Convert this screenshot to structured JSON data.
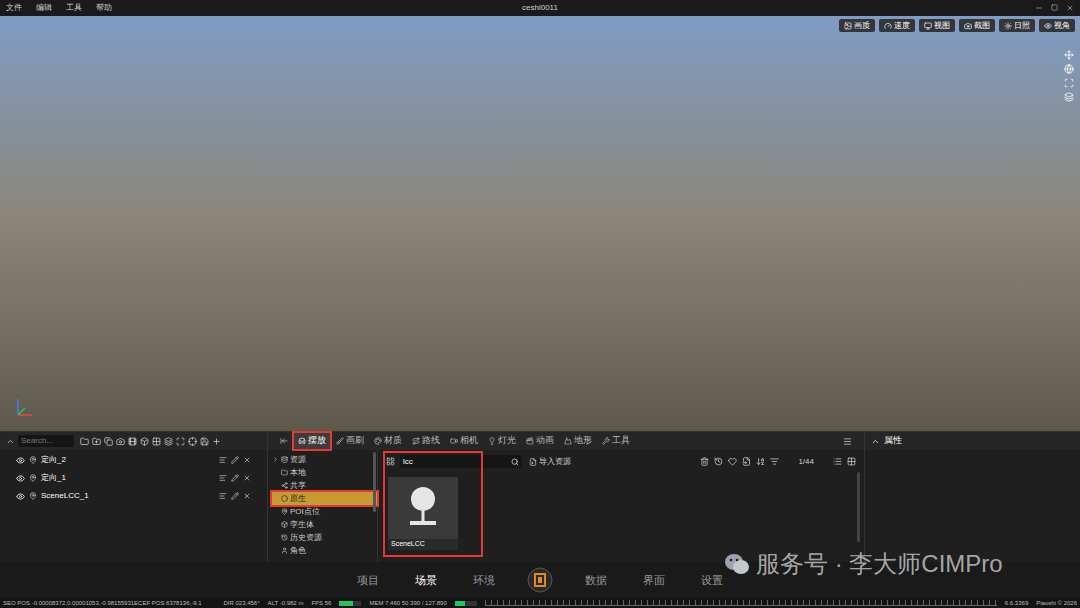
{
  "window": {
    "title": "ceshi0011",
    "menu": [
      "文件",
      "编辑",
      "工具",
      "帮助"
    ]
  },
  "viewport": {
    "toolbar": [
      {
        "label": "画质"
      },
      {
        "label": "速度"
      },
      {
        "label": "视图"
      },
      {
        "label": "截图"
      },
      {
        "label": "日照"
      },
      {
        "label": "视角"
      }
    ]
  },
  "outliner": {
    "search": {
      "placeholder": "Search..."
    },
    "items": [
      {
        "name": "定向_2",
        "visible": true,
        "selected": false
      },
      {
        "name": "定向_1",
        "visible": true,
        "selected": false
      },
      {
        "name": "SceneLCC_1",
        "visible": true,
        "selected": false
      }
    ]
  },
  "library": {
    "tabs": [
      {
        "label": "摆放",
        "selected": true,
        "annotated": true
      },
      {
        "label": "画刷",
        "selected": false,
        "annotated": false
      },
      {
        "label": "材质",
        "selected": false,
        "annotated": false
      },
      {
        "label": "路线",
        "selected": false,
        "annotated": false
      },
      {
        "label": "相机",
        "selected": false,
        "annotated": false
      },
      {
        "label": "灯光",
        "selected": false,
        "annotated": false
      },
      {
        "label": "动画",
        "selected": false,
        "annotated": false
      },
      {
        "label": "地形",
        "selected": false,
        "annotated": false
      },
      {
        "label": "工具",
        "selected": false,
        "annotated": false
      }
    ],
    "tree": [
      {
        "label": "资源",
        "selected": false,
        "annotated": false,
        "expandable": true
      },
      {
        "label": "本地",
        "selected": false,
        "annotated": false,
        "expandable": false
      },
      {
        "label": "共享",
        "selected": false,
        "annotated": false,
        "expandable": false
      },
      {
        "label": "原生",
        "selected": true,
        "annotated": true,
        "expandable": false
      },
      {
        "label": "POI点位",
        "selected": false,
        "annotated": false,
        "expandable": false
      },
      {
        "label": "孪生体",
        "selected": false,
        "annotated": false,
        "expandable": false
      },
      {
        "label": "历史资源",
        "selected": false,
        "annotated": false,
        "expandable": false
      },
      {
        "label": "角色",
        "selected": false,
        "annotated": false,
        "expandable": false
      }
    ],
    "search": {
      "value": "lcc"
    },
    "import_button": "导入资源",
    "page": "1/44",
    "assets": [
      {
        "name": "SceneLCC",
        "selected": false
      }
    ],
    "assets_annotated": true
  },
  "properties": {
    "title": "属性"
  },
  "nav": {
    "left": [
      {
        "label": "项目",
        "selected": false
      },
      {
        "label": "场景",
        "selected": true
      },
      {
        "label": "环境",
        "selected": false
      }
    ],
    "right": [
      {
        "label": "数据",
        "selected": false
      },
      {
        "label": "界面",
        "selected": false
      },
      {
        "label": "设置",
        "selected": false
      }
    ]
  },
  "status_bar": {
    "geo": "SEO POS -0.00008372,0.00001053,-0.98155931ECEF POS 6378136,-9.1",
    "dir": "DIR 023.456°",
    "alt": "ALT -0.982 m",
    "fps": {
      "label": "FPS 56",
      "level": 0.6
    },
    "mem": {
      "label": "MEM 7.460 50.390 / 127.890",
      "level": 0.45
    },
    "version": "6.6.3369",
    "copyright": "Piaoshi © 2026"
  },
  "watermark": "服务号 · 李大师CIMPro"
}
